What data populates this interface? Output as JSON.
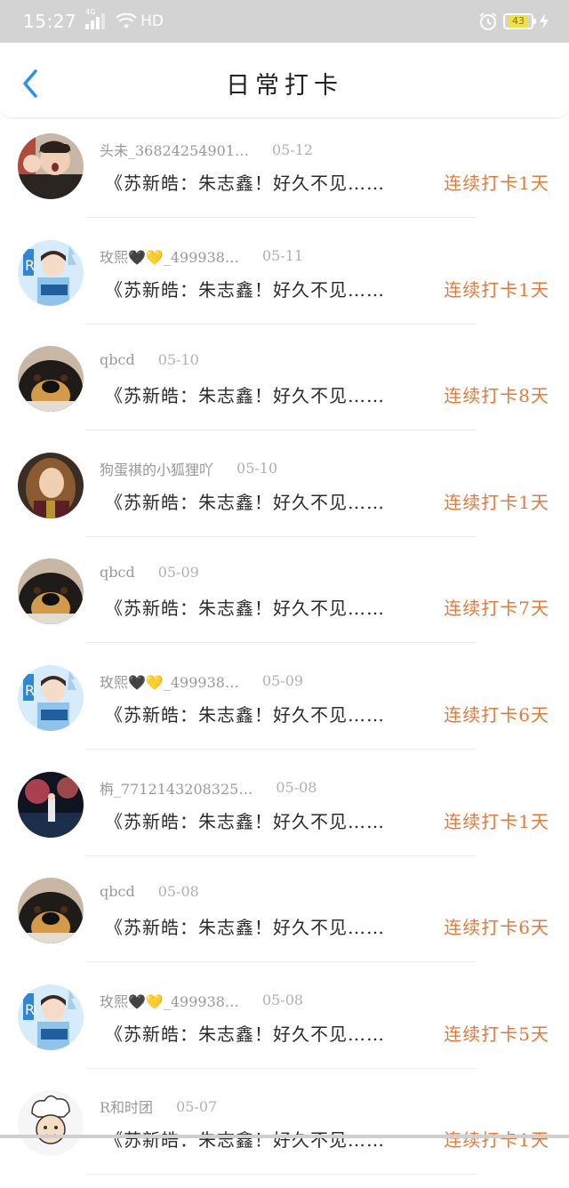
{
  "status_bar": {
    "time": "15:27",
    "network": "4G",
    "hd": "HD",
    "battery": "43"
  },
  "header": {
    "title": "日常打卡"
  },
  "items": [
    {
      "user": "头未_36824254901…",
      "date": "05-12",
      "message": "《苏新皓：朱志鑫！好久不见……",
      "streak": "连续打卡1天",
      "avatar": "photo"
    },
    {
      "user": "玫熙🖤💛_499938…",
      "date": "05-11",
      "message": "《苏新皓：朱志鑫！好久不见……",
      "streak": "连续打卡1天",
      "avatar": "blue"
    },
    {
      "user": "qbcd",
      "date": "05-10",
      "message": "《苏新皓：朱志鑫！好久不见……",
      "streak": "连续打卡8天",
      "avatar": "dog"
    },
    {
      "user": "狗蛋祺的小狐狸吖",
      "date": "05-10",
      "message": "《苏新皓：朱志鑫！好久不见……",
      "streak": "连续打卡1天",
      "avatar": "girl"
    },
    {
      "user": "qbcd",
      "date": "05-09",
      "message": "《苏新皓：朱志鑫！好久不见……",
      "streak": "连续打卡7天",
      "avatar": "dog"
    },
    {
      "user": "玫熙🖤💛_499938…",
      "date": "05-09",
      "message": "《苏新皓：朱志鑫！好久不见……",
      "streak": "连续打卡6天",
      "avatar": "blue"
    },
    {
      "user": "栴_7712143208325…",
      "date": "05-08",
      "message": "《苏新皓：朱志鑫！好久不见……",
      "streak": "连续打卡1天",
      "avatar": "dark"
    },
    {
      "user": "qbcd",
      "date": "05-08",
      "message": "《苏新皓：朱志鑫！好久不见……",
      "streak": "连续打卡6天",
      "avatar": "dog"
    },
    {
      "user": "玫熙🖤💛_499938…",
      "date": "05-08",
      "message": "《苏新皓：朱志鑫！好久不见……",
      "streak": "连续打卡5天",
      "avatar": "blue"
    },
    {
      "user": "R和时团",
      "date": "05-07",
      "message": "《苏新皓：朱志鑫！好久不见……",
      "streak": "连续打卡1天",
      "avatar": "chef"
    }
  ],
  "colors": {
    "status_bar_bg": "#d3d3d3",
    "accent_back": "#2d8cf0",
    "streak": "#e07a3b",
    "username": "#999999",
    "message": "#2b2b2b"
  },
  "icons": {
    "back": "chevron-left-icon",
    "wifi": "wifi-icon",
    "alarm": "alarm-icon",
    "charging": "bolt-icon"
  }
}
